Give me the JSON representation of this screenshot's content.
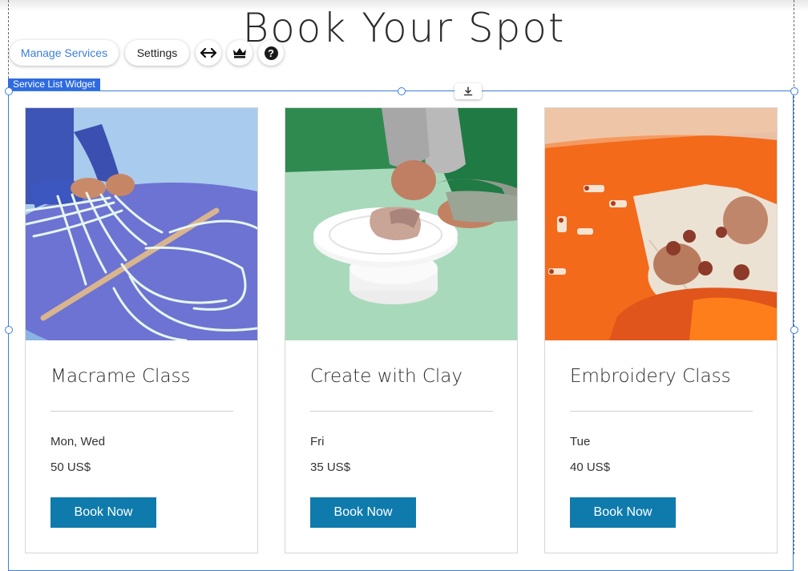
{
  "page": {
    "title": "Book Your Spot"
  },
  "toolbar": {
    "manage_label": "Manage Services",
    "settings_label": "Settings",
    "stretch_icon": "horizontal-arrows-icon",
    "upgrade_icon": "crown-icon",
    "help_icon": "question-circle-icon",
    "help_glyph": "?"
  },
  "widget": {
    "tag_label": "Service List Widget",
    "selection_color": "#3b7fd8",
    "tag_color": "#2f6be0"
  },
  "services": [
    {
      "name": "Macrame Class",
      "days": "Mon, Wed",
      "price": "50 US$",
      "button": "Book Now"
    },
    {
      "name": "Create with Clay",
      "days": "Fri",
      "price": "35 US$",
      "button": "Book Now"
    },
    {
      "name": "Embroidery Class",
      "days": "Tue",
      "price": "40 US$",
      "button": "Book Now"
    }
  ],
  "colors": {
    "button": "#0f7bad",
    "macrame_bg": "#6d73d2",
    "clay_bg": "#a8d9bb",
    "embroidery_bg": "#f36a1b"
  }
}
